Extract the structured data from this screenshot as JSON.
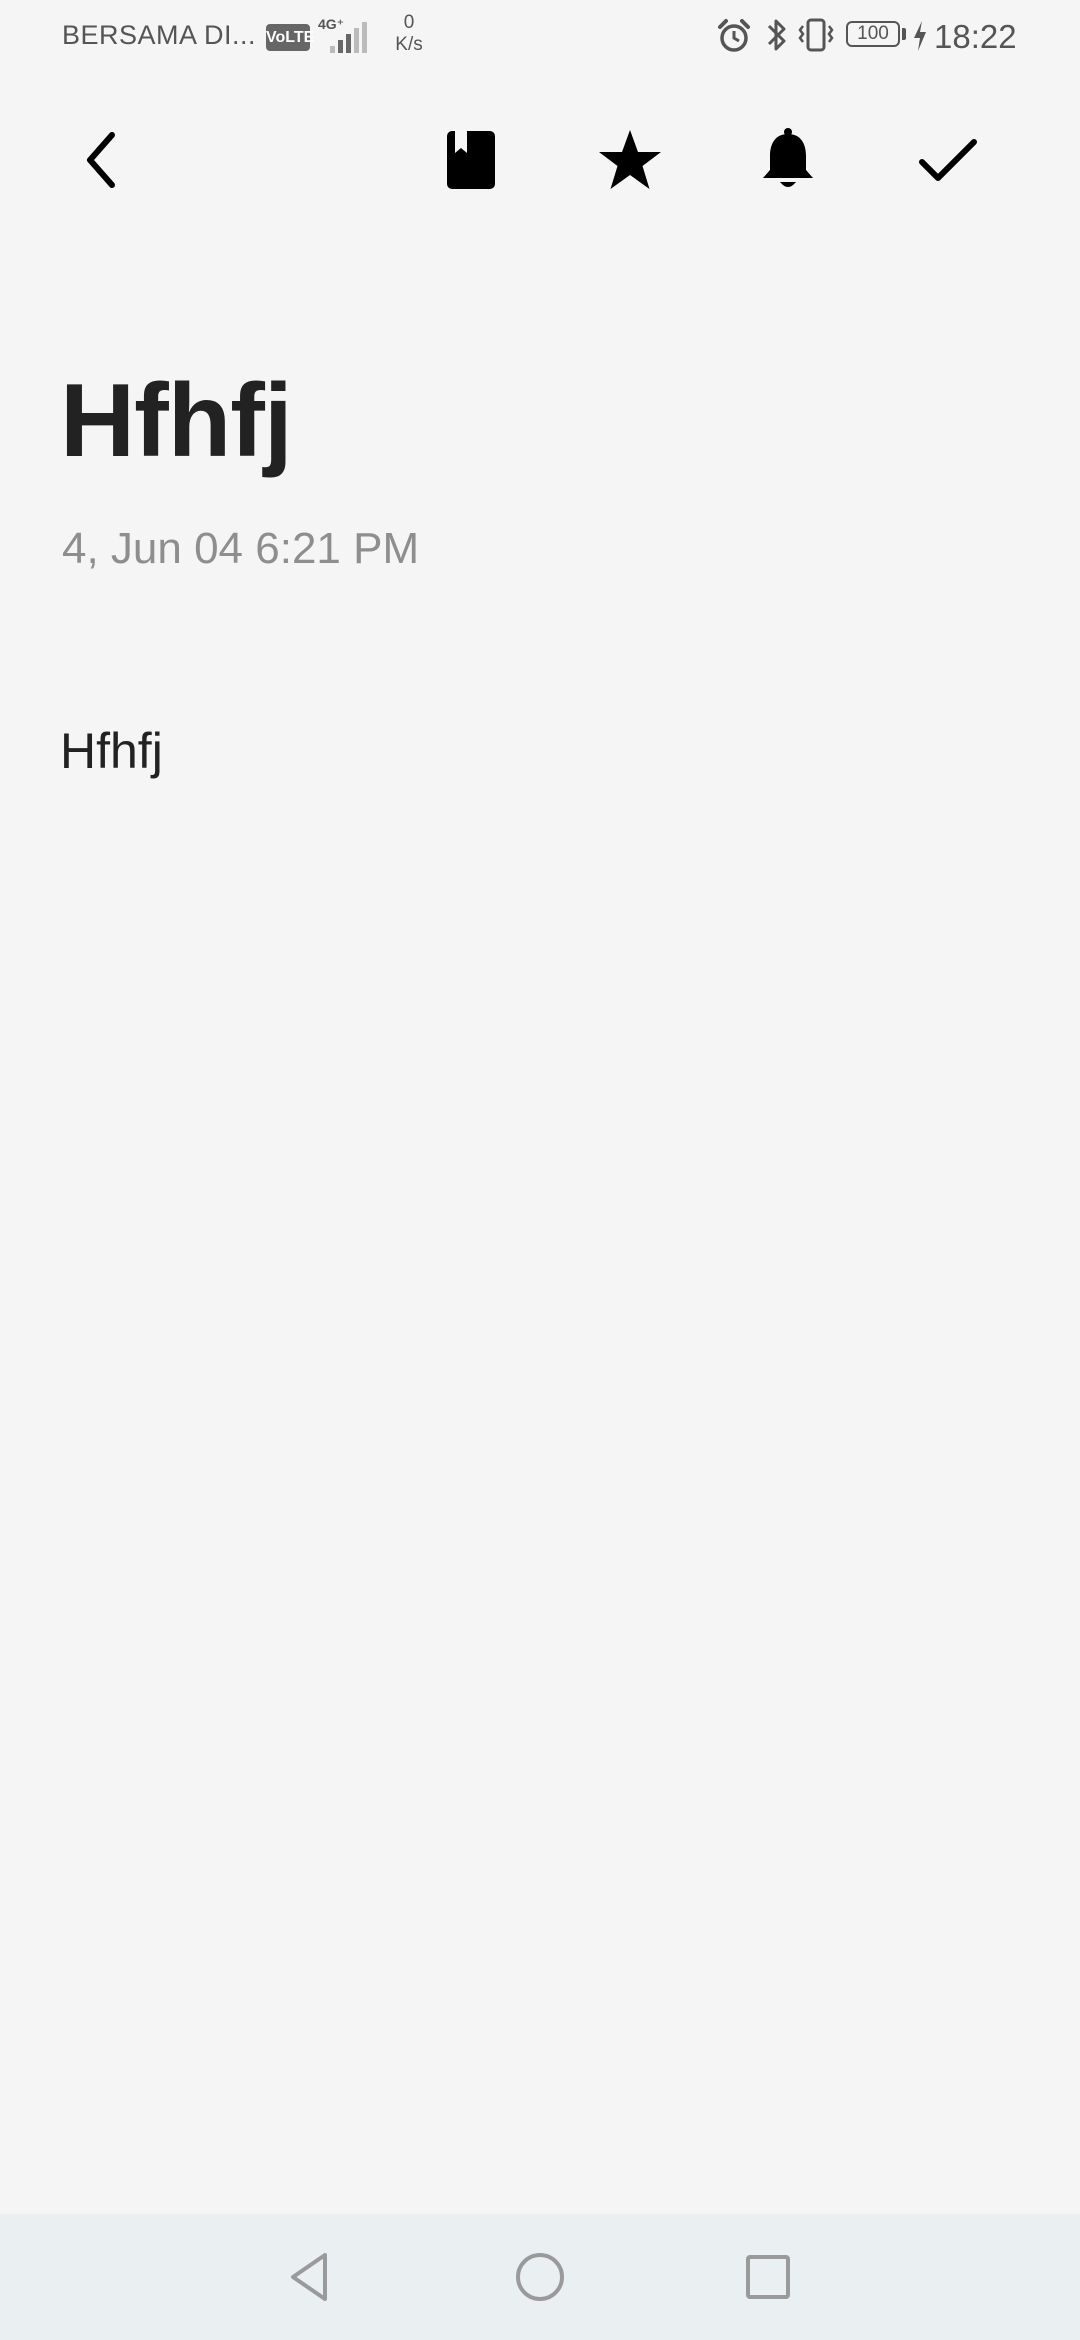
{
  "status_bar": {
    "carrier": "BERSAMA DI...",
    "volte": "VoLTE",
    "network_type": "4G⁺",
    "speed_value": "0",
    "speed_unit": "K/s",
    "battery_level": "100",
    "time": "18:22",
    "icons": [
      "alarm-icon",
      "bluetooth-icon",
      "vibrate-icon",
      "battery-icon",
      "charging-icon"
    ]
  },
  "toolbar": {
    "icons": [
      "back-arrow-icon",
      "notebook-icon",
      "star-icon",
      "bell-icon",
      "checkmark-icon"
    ]
  },
  "note": {
    "title": "Hfhfj",
    "date": "4, Jun 04 6:21 PM",
    "body": "Hfhfj"
  },
  "nav_bar": {
    "icons": [
      "triangle-back-icon",
      "circle-home-icon",
      "square-recents-icon"
    ]
  },
  "colors": {
    "background": "#f5f5f5",
    "title_text": "#222222",
    "date_text": "#8e8e8e",
    "nav_background": "#eaeff2"
  }
}
